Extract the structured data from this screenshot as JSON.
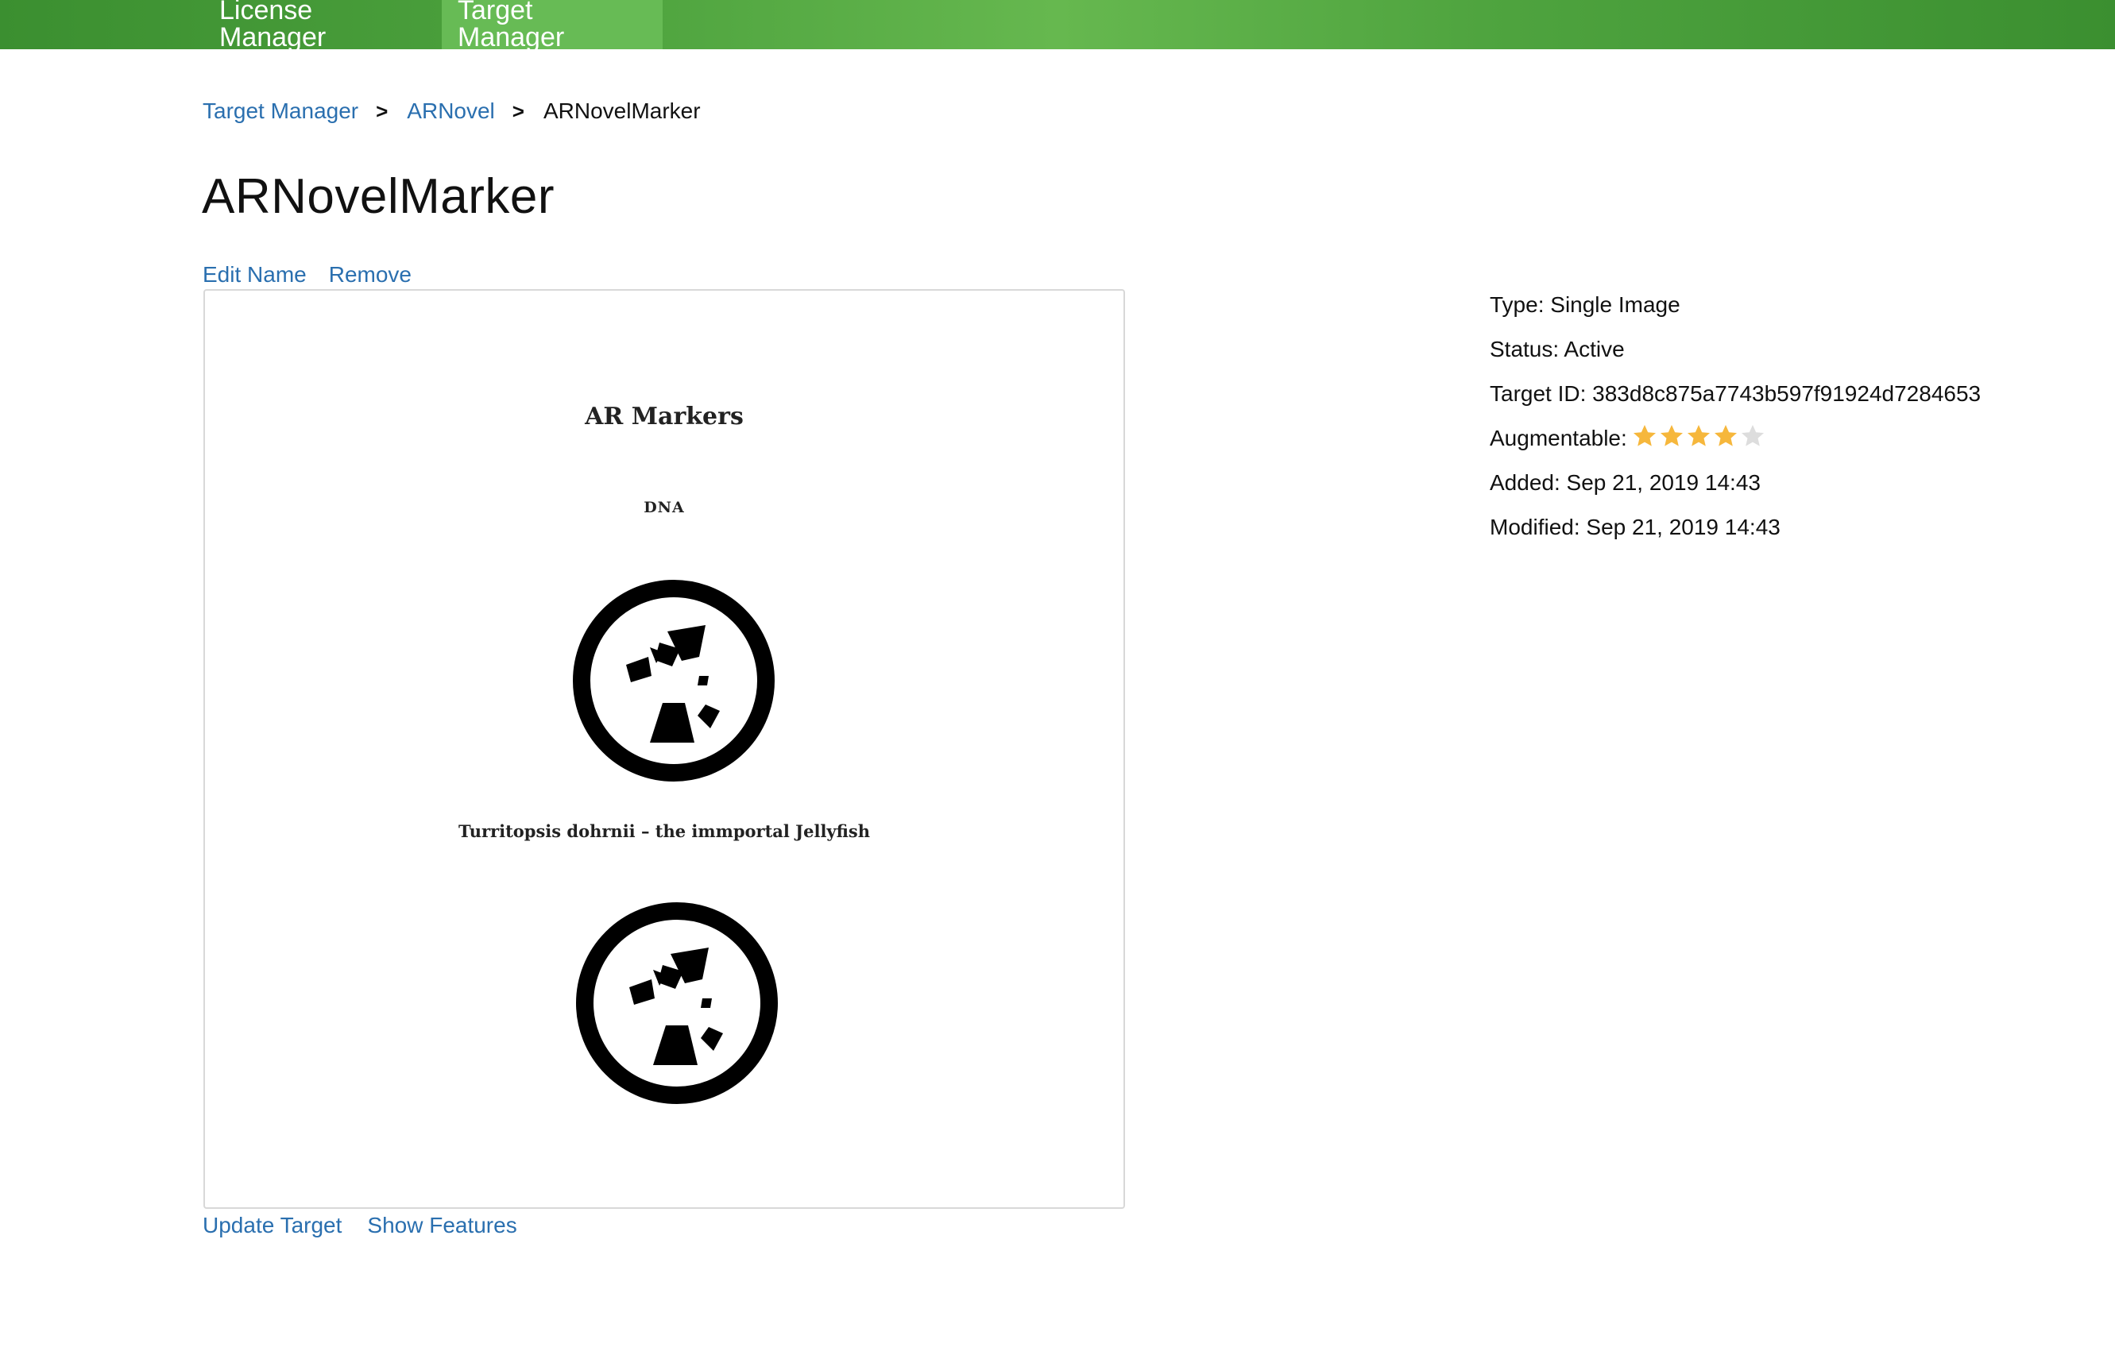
{
  "nav": {
    "tabs": [
      {
        "label": "License Manager",
        "active": false
      },
      {
        "label": "Target Manager",
        "active": true
      }
    ],
    "bar_color": "#4fa43f"
  },
  "breadcrumb": {
    "items": [
      "Target Manager",
      "ARNovel",
      "ARNovelMarker"
    ],
    "separator": ">"
  },
  "page": {
    "title": "ARNovelMarker",
    "edit_name_label": "Edit Name",
    "remove_label": "Remove",
    "update_target_label": "Update Target",
    "show_features_label": "Show Features"
  },
  "target_image": {
    "heading": "AR Markers",
    "subheading": "DNA",
    "caption": "Turritopsis dohrnii – the immportal Jellyfish",
    "marker_icons": [
      "circular-fiducial-marker-icon",
      "circular-fiducial-marker-icon"
    ]
  },
  "details": {
    "type": "Type: Single Image",
    "status": "Status: Active",
    "target_id": "Target ID: 383d8c875a7743b597f91924d7284653",
    "augmentable_label": "Augmentable:",
    "augmentable_rating": 4,
    "augmentable_max": 5,
    "added": "Added: Sep 21, 2019 14:43",
    "modified": "Modified: Sep 21, 2019 14:43",
    "star_color": "#f6b73c",
    "star_empty_color": "#dddddd"
  },
  "link_color": "#2a6faf"
}
